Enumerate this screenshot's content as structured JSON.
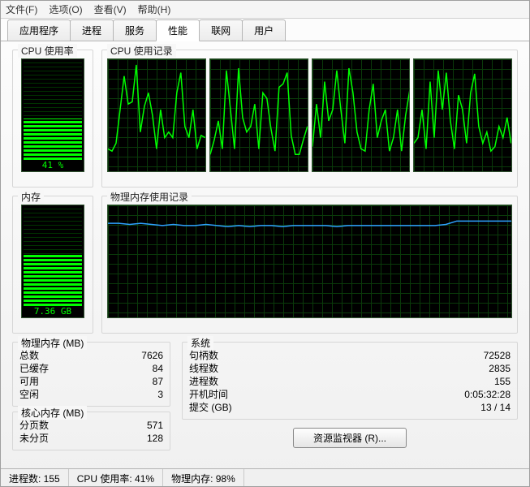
{
  "menu": {
    "file": "文件(F)",
    "options": "选项(O)",
    "view": "查看(V)",
    "help": "帮助(H)"
  },
  "tabs": {
    "apps": "应用程序",
    "processes": "进程",
    "services": "服务",
    "performance": "性能",
    "networking": "联网",
    "users": "用户"
  },
  "groups": {
    "cpu_usage": "CPU 使用率",
    "cpu_history": "CPU 使用记录",
    "memory": "内存",
    "mem_history": "物理内存使用记录",
    "phys_mem": "物理内存 (MB)",
    "kernel_mem": "核心内存 (MB)",
    "system": "系统"
  },
  "cpu_meter": {
    "percent": 41,
    "label": "41 %"
  },
  "mem_meter": {
    "percent": 52,
    "label": "7.36 GB"
  },
  "phys_mem": {
    "total_k": "总数",
    "total_v": "7626",
    "cached_k": "已缓存",
    "cached_v": "84",
    "avail_k": "可用",
    "avail_v": "87",
    "free_k": "空闲",
    "free_v": "3"
  },
  "kernel_mem": {
    "paged_k": "分页数",
    "paged_v": "571",
    "nonpaged_k": "未分页",
    "nonpaged_v": "128"
  },
  "system": {
    "handles_k": "句柄数",
    "handles_v": "72528",
    "threads_k": "线程数",
    "threads_v": "2835",
    "procs_k": "进程数",
    "procs_v": "155",
    "uptime_k": "开机时间",
    "uptime_v": "0:05:32:28",
    "commit_k": "提交 (GB)",
    "commit_v": "13 / 14"
  },
  "button": {
    "resmon": "资源监视器 (R)..."
  },
  "status": {
    "procs": "进程数: 155",
    "cpu": "CPU 使用率: 41%",
    "mem": "物理内存: 98%"
  },
  "chart_data": [
    {
      "type": "line",
      "title": "CPU Core 1",
      "ylim": [
        0,
        100
      ],
      "values": [
        20,
        18,
        25,
        55,
        85,
        60,
        62,
        95,
        35,
        58,
        70,
        50,
        20,
        55,
        30,
        35,
        30,
        70,
        88,
        40,
        30,
        55,
        20,
        32,
        30
      ]
    },
    {
      "type": "line",
      "title": "CPU Core 2",
      "ylim": [
        0,
        100
      ],
      "values": [
        15,
        28,
        45,
        20,
        90,
        55,
        20,
        92,
        48,
        35,
        40,
        60,
        20,
        70,
        65,
        38,
        18,
        75,
        78,
        88,
        32,
        15,
        15,
        28,
        40
      ]
    },
    {
      "type": "line",
      "title": "CPU Core 3",
      "ylim": [
        0,
        100
      ],
      "values": [
        22,
        60,
        30,
        80,
        45,
        55,
        90,
        55,
        25,
        92,
        70,
        35,
        20,
        18,
        55,
        78,
        30,
        45,
        55,
        18,
        30,
        55,
        18,
        50,
        72
      ]
    },
    {
      "type": "line",
      "title": "CPU Core 4",
      "ylim": [
        0,
        100
      ],
      "values": [
        25,
        30,
        55,
        20,
        80,
        30,
        90,
        55,
        88,
        45,
        20,
        68,
        55,
        25,
        70,
        87,
        40,
        25,
        35,
        18,
        22,
        40,
        30,
        48,
        25
      ]
    },
    {
      "type": "line",
      "title": "Physical Memory",
      "ylim": [
        0,
        100
      ],
      "color": "#2ea1ff",
      "values": [
        84,
        84,
        83,
        84,
        83,
        82,
        83,
        82,
        82,
        83,
        82,
        81,
        82,
        81,
        82,
        82,
        81,
        82,
        82,
        82,
        82,
        81,
        82,
        82,
        82,
        82,
        82,
        82,
        82,
        82,
        82,
        83,
        86,
        86,
        86,
        86,
        86,
        86
      ]
    }
  ]
}
